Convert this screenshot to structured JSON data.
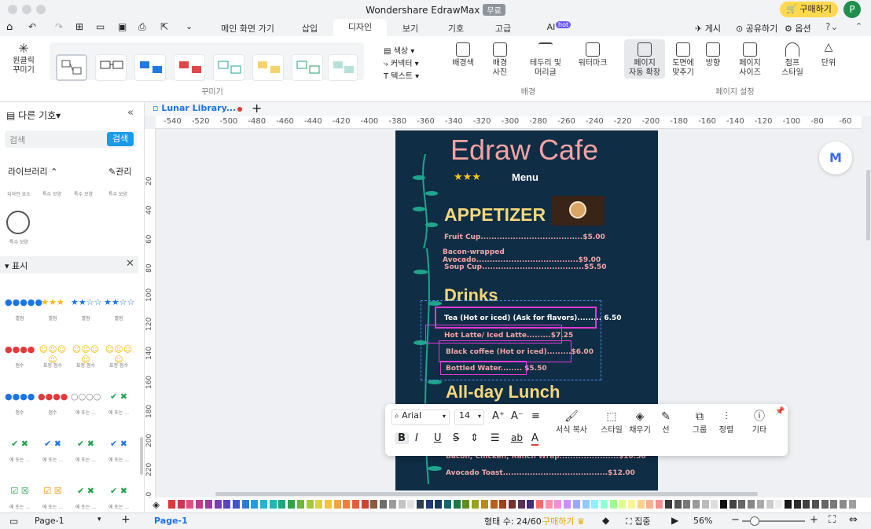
{
  "app": {
    "title": "Wondershare EdrawMax",
    "badge": "무료",
    "buy": "구매하기",
    "avatar": "P"
  },
  "tabs": [
    "메인 화면 가기",
    "삽입",
    "디자인",
    "보기",
    "기호",
    "고급",
    "AI"
  ],
  "ai_badge": "hot",
  "top_actions": {
    "publish": "게시",
    "share": "공유하기",
    "options": "옵션"
  },
  "ribbon": {
    "one_click": "원클릭\n꾸미기",
    "beautify_label": "꾸미기",
    "color": "색상",
    "connector": "커넥터",
    "text": "텍스트",
    "bg_color": "배경색",
    "bg_photo": "배경\n사진",
    "border_title": "테두리 및\n머리글",
    "watermark": "워터마크",
    "background_label": "배경",
    "auto_extend": "페이지\n자동 확장",
    "fit_drawing": "도면에\n맞추기",
    "orientation": "방향",
    "page_size": "페이지\n사이즈",
    "jump_style": "점프\n스타일",
    "unit": "단위",
    "page_setup_label": "페이지 설정"
  },
  "left": {
    "more_symbols": "다른 기호",
    "search_placeholder": "검색",
    "search_btn": "검색",
    "library": "라이브러리",
    "manage": "관리",
    "lib_items": [
      "디자인 요소",
      "특수 모양",
      "특수 모양",
      "특수 모양"
    ],
    "special_shape": "특수 모양",
    "display": "표시",
    "rating_rows": [
      [
        "별점",
        "별점",
        "별점",
        "별점"
      ],
      [
        "점수",
        "표정 점수",
        "표정 점수",
        "표정 점수"
      ],
      [
        "점수",
        "점수",
        "에 또는 ...",
        "에 또는 ..."
      ],
      [
        "에 또는 ...",
        "에 또는 ...",
        "에 또는 ...",
        "에 또는 ..."
      ],
      [
        "에 또는 ...",
        "에 또는 ...",
        "에 또는 ...",
        "에 또는 ..."
      ]
    ]
  },
  "doc_tab": "Lunar Library...",
  "ruler_top": [
    "-540",
    "-520",
    "-500",
    "-480",
    "-460",
    "-440",
    "-420",
    "-400",
    "-380",
    "-360",
    "-340",
    "-320",
    "-300",
    "-280",
    "-260",
    "-240",
    "-220",
    "-200",
    "-180",
    "-160",
    "-140",
    "-120",
    "-100",
    "-80",
    "-60"
  ],
  "ruler_left": [
    "20",
    "40",
    "60",
    "80",
    "100",
    "120",
    "140",
    "160",
    "180",
    "200",
    "220",
    "240"
  ],
  "menu": {
    "title": "Edraw Cafe",
    "subtitle": "Menu",
    "appetizer": "APPETIZER",
    "items_app": [
      "Fruit Cup......................................$5.00",
      "Bacon-wrapped Avocado......................................$9.00",
      "Soup Cup......................................$5.50"
    ],
    "drinks": "Drinks",
    "items_drinks": [
      "Tea (Hot or iced) (Ask for flavors)......... 6.50",
      "Hot Latte/ Iced Latte.........$7.25",
      "Black coffee (Hot or iced).........$6.00",
      "Bottled Water........ $5.50"
    ],
    "lunch": "All-day Lunch",
    "items_lunch": [
      "Bacon, Chicken, Ranch Wrap......................$10.50",
      "Avocado Toast.......................................$12.00"
    ]
  },
  "floatbar": {
    "font": "Arial",
    "size": "14",
    "format_copy": "서식 복사",
    "style": "스타일",
    "fill": "채우기",
    "line": "선",
    "group": "그룹",
    "align": "정렬",
    "more": "기타"
  },
  "status": {
    "page_select": "Page-1",
    "page_tab": "Page-1",
    "shape_count": "형태 수: 24/60",
    "buy": "구매하기",
    "focus": "집중",
    "zoom": "56%"
  },
  "palette": [
    "#e23a3a",
    "#d43355",
    "#e84c82",
    "#c23b8a",
    "#a03ca0",
    "#7c3fb0",
    "#5b46bf",
    "#3f57c9",
    "#2f79d9",
    "#2a9ae0",
    "#23b3d8",
    "#1fb7b0",
    "#22a679",
    "#2fa34a",
    "#6bb83a",
    "#a7c83a",
    "#d8d43b",
    "#f2c43b",
    "#f4a43a",
    "#ef7f3a",
    "#e95d3a",
    "#c9472f",
    "#8a5a3a",
    "#6d6d6d",
    "#9b9b9b",
    "#c4c4c4",
    "#e2e2e2",
    "#2c3e50",
    "#1f3b73",
    "#183a5a",
    "#0f6a6a",
    "#1c7a45",
    "#5d8f1f",
    "#9aa21f",
    "#b88a1f",
    "#b3621f",
    "#a0401f",
    "#7a2f2f",
    "#5a2f5a",
    "#3f2f7a",
    "#ff6b6b",
    "#ff8fab",
    "#f78fd5",
    "#c98fff",
    "#9aa8ff",
    "#8fc9ff",
    "#8ff0ff",
    "#8fffd6",
    "#9cff8f",
    "#e0ff8f",
    "#fff38f",
    "#ffd18f",
    "#ffb08f",
    "#ff8f8f",
    "#3a3a3a",
    "#555555",
    "#777777",
    "#999999",
    "#bbbbbb",
    "#dddddd",
    "#111111",
    "#444444",
    "#666666",
    "#888888",
    "#aaaaaa",
    "#cccccc",
    "#eeeeee",
    "#1a1a1a",
    "#2d2d2d",
    "#404040",
    "#535353",
    "#666666",
    "#797979",
    "#8c8c8c",
    "#9f9f9f"
  ]
}
